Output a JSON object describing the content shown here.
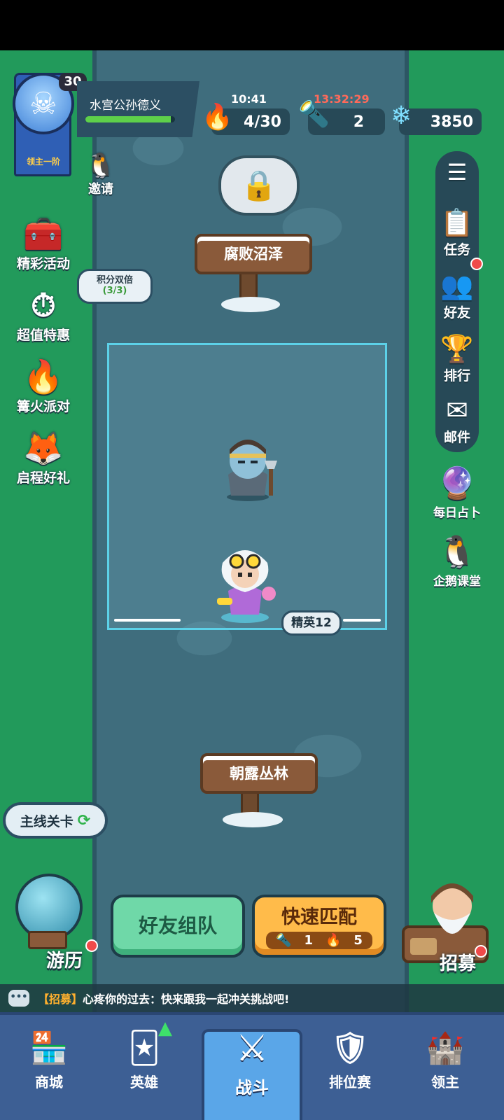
{
  "player": {
    "name": "水宫公孙德义",
    "level": "30",
    "rank": "领主一阶",
    "hp_fraction": 0.95
  },
  "resources": {
    "stamina": {
      "timer": "10:41",
      "value": "4/30",
      "icon": "flame-plus-icon"
    },
    "torch": {
      "timer": "13:32:29",
      "value": "2",
      "icon": "torch-icon"
    },
    "gems": {
      "value": "3850",
      "icon": "crystal-plus-icon"
    }
  },
  "left_menu": {
    "invite": "邀请",
    "activities": "精彩活动",
    "deals": "超值特惠",
    "bonfire": "篝火派对",
    "start_gift": "启程好礼",
    "score_bubble": {
      "title": "积分双倍",
      "progress": "(3/3)"
    }
  },
  "right_menu": {
    "tasks": "任务",
    "friends": "好友",
    "ranking": "排行",
    "mail": "邮件",
    "daily_fortune": "每日占卜",
    "penguin_class": "企鹅课堂"
  },
  "map": {
    "locked_area": "腐败沼泽",
    "current_area": "朝露丛林",
    "stage_tag": "精英12",
    "mainline_label": "主线关卡"
  },
  "actions": {
    "team_up": "好友组队",
    "quick_match": "快速匹配",
    "quick_cost_torch": "1",
    "quick_cost_flame": "5",
    "travel": "游历",
    "recruit": "招募"
  },
  "chat": {
    "tag": "【招募】",
    "message": "心疼你的过去：快来跟我一起冲关挑战吧!"
  },
  "nav": {
    "shop": "商城",
    "heroes": "英雄",
    "battle": "战斗",
    "ranked": "排位赛",
    "lord": "领主"
  },
  "colors": {
    "accent_green": "#5ed04a",
    "quick_orange": "#ffbb4a",
    "team_green": "#6fd8a8",
    "nav_blue": "#3d5f94"
  }
}
